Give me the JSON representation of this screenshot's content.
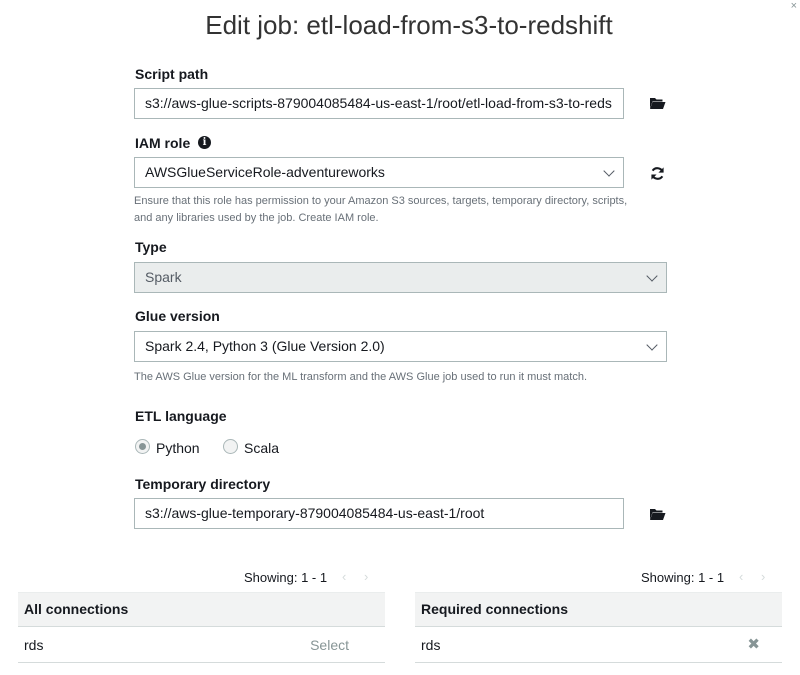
{
  "dialog": {
    "title": "Edit job: etl-load-from-s3-to-redshift",
    "close_glyph": "×"
  },
  "script_path": {
    "label": "Script path",
    "value": "s3://aws-glue-scripts-879004085484-us-east-1/root/etl-load-from-s3-to-reds",
    "browse_icon": "folder-open-icon"
  },
  "iam_role": {
    "label": "IAM role",
    "info_glyph": "i",
    "selected": "AWSGlueServiceRole-adventureworks",
    "refresh_icon": "refresh-icon",
    "help": "Ensure that this role has permission to your Amazon S3 sources, targets, temporary directory, scripts, and any libraries used by the job. Create IAM role."
  },
  "type": {
    "label": "Type",
    "selected": "Spark"
  },
  "glue_version": {
    "label": "Glue version",
    "selected": "Spark 2.4, Python 3 (Glue Version 2.0)",
    "help": "The AWS Glue version for the ML transform and the AWS Glue job used to run it must match."
  },
  "etl_language": {
    "label": "ETL language",
    "options": [
      {
        "label": "Python",
        "checked": true
      },
      {
        "label": "Scala",
        "checked": false
      }
    ]
  },
  "temp_dir": {
    "label": "Temporary directory",
    "value": "s3://aws-glue-temporary-879004085484-us-east-1/root",
    "browse_icon": "folder-open-icon"
  },
  "all_connections": {
    "showing": "Showing: 1 - 1",
    "prev": "‹",
    "next": "›",
    "header": "All connections",
    "rows": [
      {
        "name": "rds",
        "action": "Select"
      }
    ]
  },
  "required_connections": {
    "showing": "Showing: 1 - 1",
    "prev": "‹",
    "next": "›",
    "header": "Required connections",
    "rows": [
      {
        "name": "rds",
        "remove_glyph": "✖"
      }
    ]
  },
  "colors": {
    "text": "#16191f",
    "border": "#aab7b8",
    "muted": "#687078",
    "panel_bg": "#f2f3f3"
  }
}
